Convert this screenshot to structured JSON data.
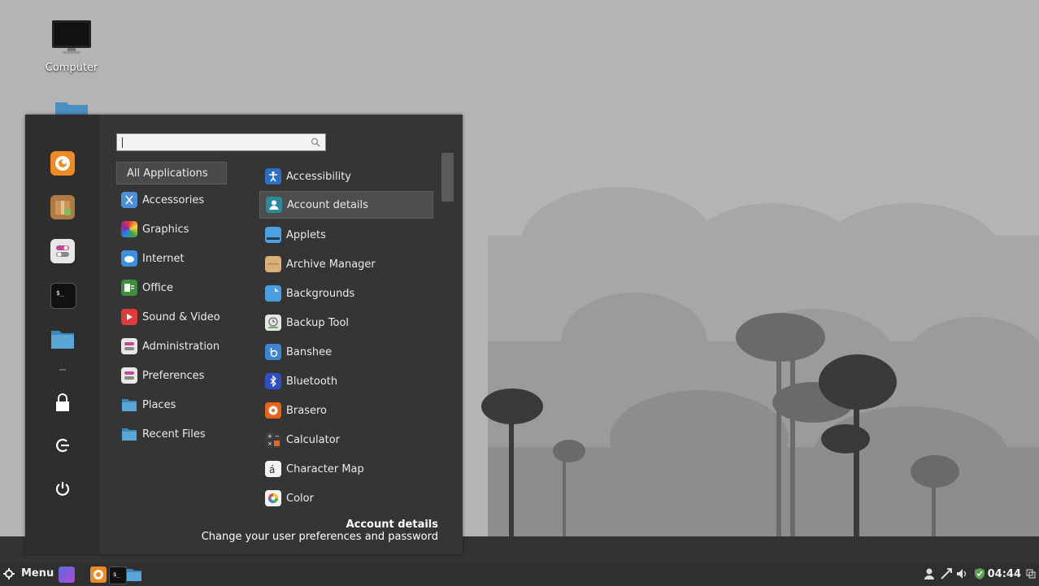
{
  "desktop": {
    "icons": [
      {
        "label": "Computer",
        "icon": "computer-icon"
      },
      {
        "label": "",
        "icon": "home-folder-icon"
      }
    ]
  },
  "menu": {
    "search": {
      "value": "",
      "placeholder": ""
    },
    "favorites": [
      "firefox-icon",
      "package-manager-icon",
      "settings-icon",
      "terminal-icon",
      "files-icon"
    ],
    "system": [
      "lock-icon",
      "logout-icon",
      "power-icon"
    ],
    "categories": [
      {
        "label": "All Applications",
        "icon": "none"
      },
      {
        "label": "Accessories",
        "icon": "accessories-icon"
      },
      {
        "label": "Graphics",
        "icon": "graphics-icon"
      },
      {
        "label": "Internet",
        "icon": "internet-icon"
      },
      {
        "label": "Office",
        "icon": "office-icon"
      },
      {
        "label": "Sound & Video",
        "icon": "sound-video-icon"
      },
      {
        "label": "Administration",
        "icon": "administration-icon"
      },
      {
        "label": "Preferences",
        "icon": "preferences-icon"
      },
      {
        "label": "Places",
        "icon": "folder-icon"
      },
      {
        "label": "Recent Files",
        "icon": "folder-icon"
      }
    ],
    "apps": [
      {
        "label": "Accessibility",
        "icon": "accessibility-icon"
      },
      {
        "label": "Account details",
        "icon": "account-icon"
      },
      {
        "label": "Applets",
        "icon": "applets-icon"
      },
      {
        "label": "Archive Manager",
        "icon": "archive-icon"
      },
      {
        "label": "Backgrounds",
        "icon": "backgrounds-icon"
      },
      {
        "label": "Backup Tool",
        "icon": "backup-icon"
      },
      {
        "label": "Banshee",
        "icon": "banshee-icon"
      },
      {
        "label": "Bluetooth",
        "icon": "bluetooth-icon"
      },
      {
        "label": "Brasero",
        "icon": "brasero-icon"
      },
      {
        "label": "Calculator",
        "icon": "calculator-icon"
      },
      {
        "label": "Character Map",
        "icon": "charmap-icon"
      },
      {
        "label": "Color",
        "icon": "color-icon"
      }
    ],
    "description": {
      "title": "Account details",
      "text": "Change your user preferences and password"
    }
  },
  "panel": {
    "menu_label": "Menu",
    "clock": "04:44"
  },
  "colors": {
    "menu_bg": "#353535",
    "panel_bg": "#2f2f2f",
    "accent": "#4d4d4d"
  }
}
